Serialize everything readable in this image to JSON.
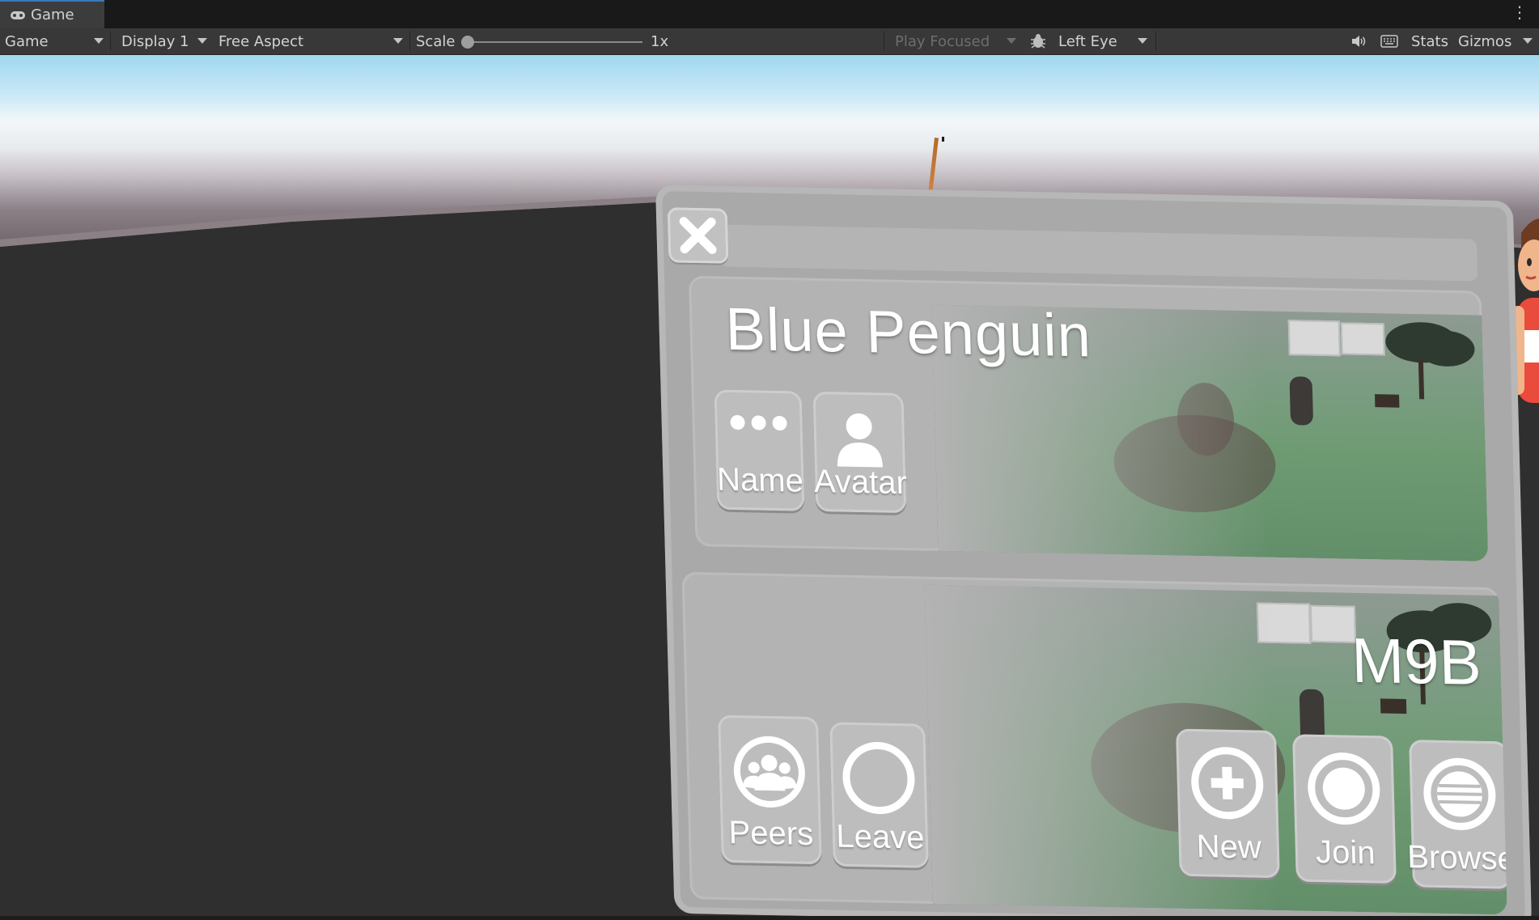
{
  "tab": {
    "label": "Game",
    "icon": "gamepad-icon"
  },
  "toolbar": {
    "view_select": "Game",
    "display_select": "Display 1",
    "aspect_select": "Free Aspect",
    "scale_label": "Scale",
    "scale_value": "1x",
    "play_focused": "Play Focused",
    "eye_select": "Left Eye",
    "stats_label": "Stats",
    "gizmos_label": "Gizmos"
  },
  "panel": {
    "player_name": "Blue Penguin",
    "room_code": "M9B",
    "profile_buttons": [
      {
        "label": "Name",
        "icon": "ellipsis-icon"
      },
      {
        "label": "Avatar",
        "icon": "person-icon"
      }
    ],
    "session_buttons": [
      {
        "label": "Peers",
        "icon": "group-icon"
      },
      {
        "label": "Leave",
        "icon": "ring-icon"
      }
    ],
    "room_buttons": [
      {
        "label": "New",
        "icon": "plus-circle-icon"
      },
      {
        "label": "Join",
        "icon": "join-circle-icon"
      },
      {
        "label": "Browse",
        "icon": "list-circle-icon"
      }
    ]
  },
  "colors": {
    "editor_toolbar": "#383838",
    "panel_bg": "#a9a9a9",
    "tile_bg": "#bdbdbd",
    "pointer_ray": "#f0a06a"
  }
}
